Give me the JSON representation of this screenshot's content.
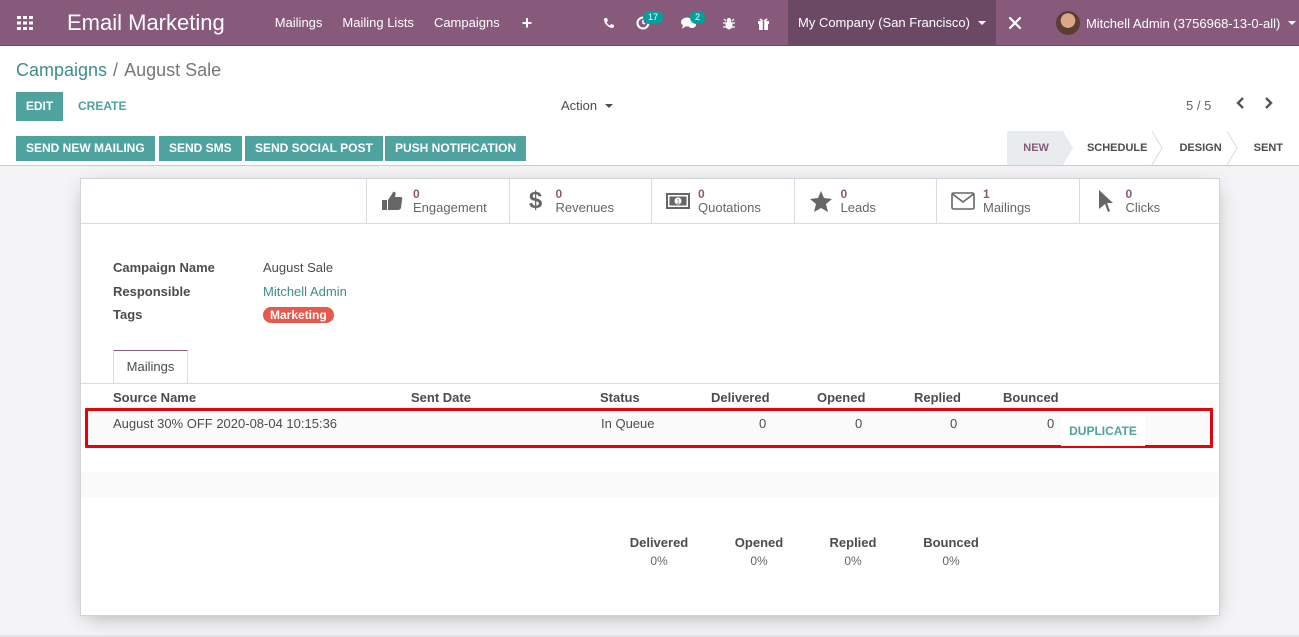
{
  "navbar": {
    "app_title": "Email Marketing",
    "menu": [
      "Mailings",
      "Mailing Lists",
      "Campaigns"
    ],
    "add_icon": "plus-icon",
    "activity_badge": "17",
    "messages_badge": "2",
    "company": "My Company (San Francisco)",
    "user": "Mitchell Admin (3756968-13-0-all)"
  },
  "breadcrumb": {
    "parent": "Campaigns",
    "separator": "/",
    "current": "August Sale"
  },
  "toolbar": {
    "edit": "EDIT",
    "create": "CREATE",
    "action": "Action",
    "pager": "5 / 5"
  },
  "statusbar": {
    "buttons": [
      "SEND NEW MAILING",
      "SEND SMS",
      "SEND SOCIAL POST",
      "PUSH NOTIFICATION"
    ],
    "stages": [
      "NEW",
      "SCHEDULE",
      "DESIGN",
      "SENT"
    ],
    "active_stage": "NEW"
  },
  "smart_buttons": [
    {
      "icon": "thumbs-up-icon",
      "value": "0",
      "label": "Engagement"
    },
    {
      "icon": "dollar-icon",
      "value": "0",
      "label": "Revenues"
    },
    {
      "icon": "money-icon",
      "value": "0",
      "label": "Quotations"
    },
    {
      "icon": "star-icon",
      "value": "0",
      "label": "Leads"
    },
    {
      "icon": "envelope-icon",
      "value": "1",
      "label": "Mailings"
    },
    {
      "icon": "pointer-icon",
      "value": "0",
      "label": "Clicks"
    }
  ],
  "form": {
    "campaign_name_label": "Campaign Name",
    "campaign_name": "August Sale",
    "responsible_label": "Responsible",
    "responsible": "Mitchell Admin",
    "tags_label": "Tags",
    "tag": "Marketing",
    "tag_color": "#e7594c"
  },
  "tabs": [
    "Mailings"
  ],
  "table": {
    "headers": [
      "Source Name",
      "Sent Date",
      "Status",
      "Delivered",
      "Opened",
      "Replied",
      "Bounced"
    ],
    "rows": [
      {
        "source": "August 30% OFF 2020-08-04 10:15:36",
        "sent_date": "",
        "status": "In Queue",
        "delivered": "0",
        "opened": "0",
        "replied": "0",
        "bounced": "0",
        "action": "DUPLICATE"
      }
    ]
  },
  "totals": [
    {
      "label": "Delivered",
      "value": "0%"
    },
    {
      "label": "Opened",
      "value": "0%"
    },
    {
      "label": "Replied",
      "value": "0%"
    },
    {
      "label": "Bounced",
      "value": "0%"
    }
  ],
  "colors": {
    "brand": "#875a7b",
    "accent": "#4ea39e",
    "highlight_border": "#e8000b"
  }
}
